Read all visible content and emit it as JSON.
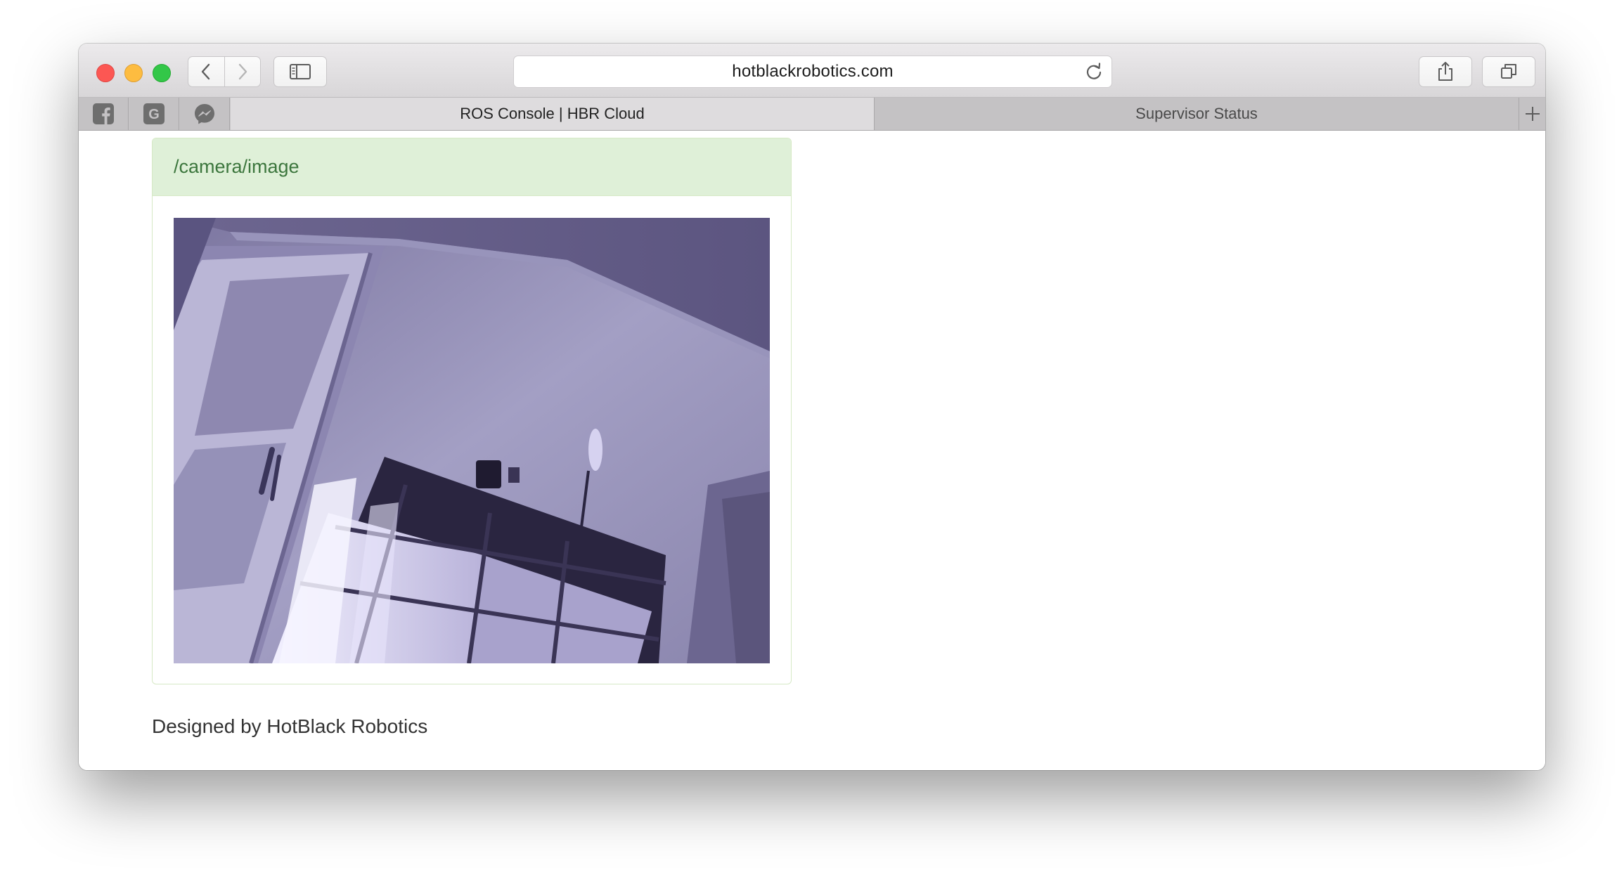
{
  "browser": {
    "url": "hotblackrobotics.com",
    "pinned_tabs": [
      {
        "icon": "facebook-icon"
      },
      {
        "icon": "google-icon"
      },
      {
        "icon": "messenger-icon"
      }
    ],
    "tabs": [
      {
        "label": "ROS Console | HBR Cloud",
        "active": true
      },
      {
        "label": "Supervisor Status",
        "active": false
      }
    ]
  },
  "panel": {
    "title": "/camera/image",
    "image": {
      "description_icon": "camera-feed"
    }
  },
  "footer": {
    "text": "Designed by HotBlack Robotics"
  },
  "colors": {
    "panel_heading_bg": "#dff0d8",
    "panel_border": "#d6e9c6",
    "panel_title": "#3c763d"
  }
}
